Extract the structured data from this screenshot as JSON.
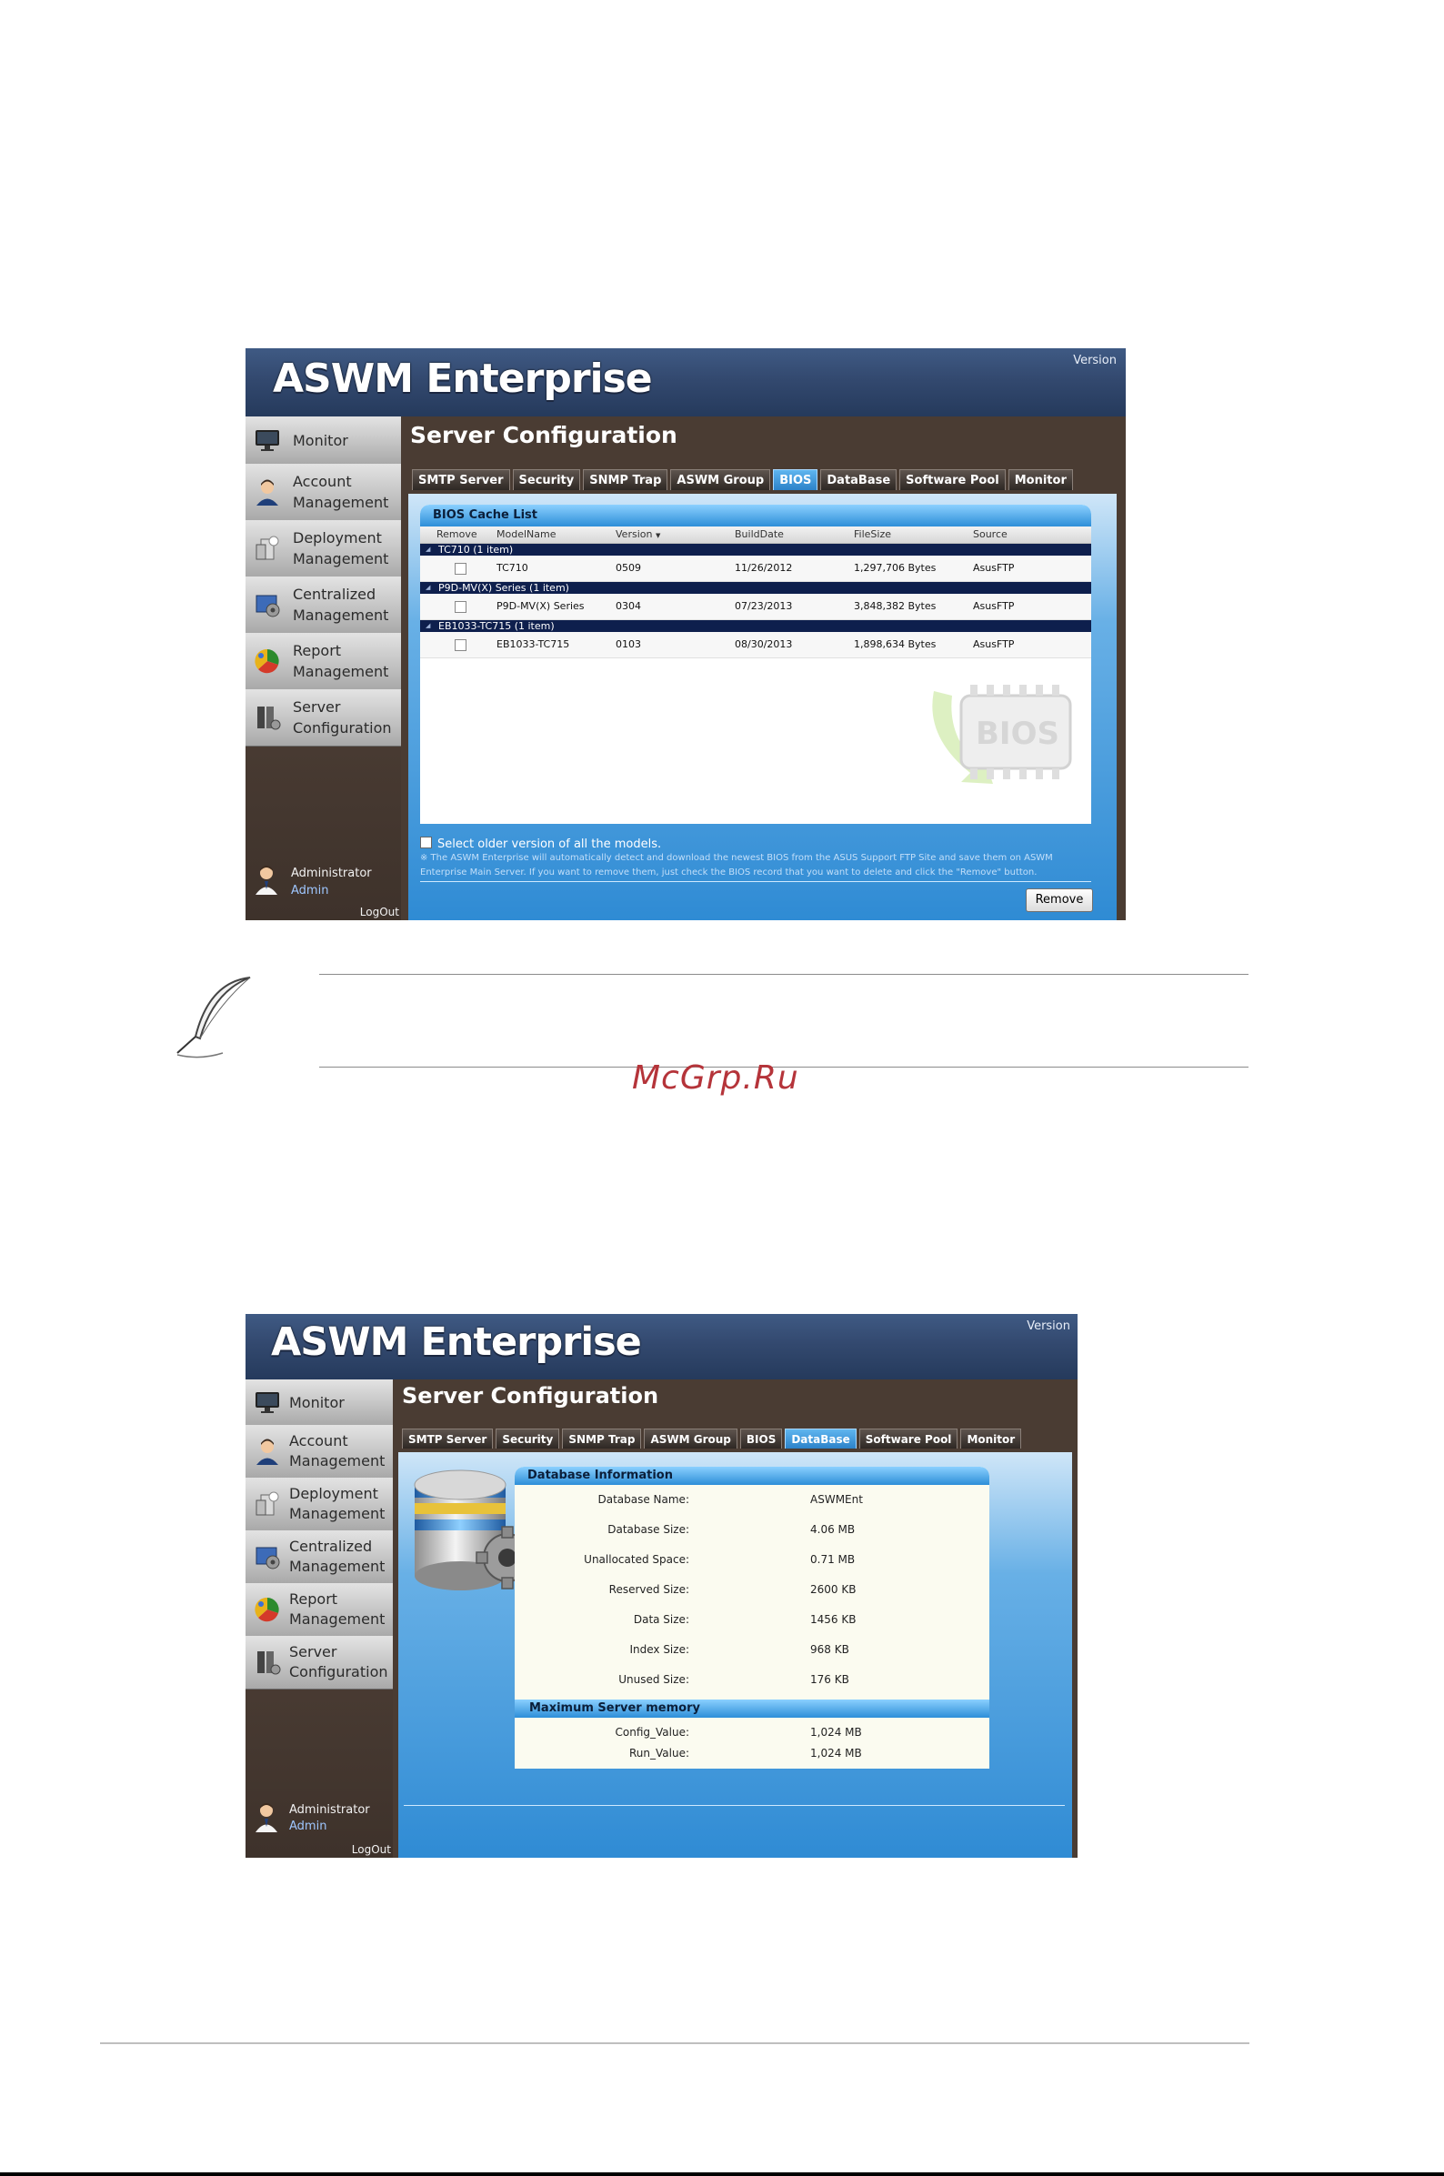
{
  "watermark": "McGrp.Ru",
  "app": {
    "brand": "ASWM Enterprise",
    "version_label": "Version",
    "page_title": "Server Configuration",
    "nav": [
      {
        "label1": "Monitor",
        "label2": "",
        "icon": "monitor-icon"
      },
      {
        "label1": "Account",
        "label2": "Management",
        "icon": "user-icon"
      },
      {
        "label1": "Deployment",
        "label2": "Management",
        "icon": "deployment-icon"
      },
      {
        "label1": "Centralized",
        "label2": "Management",
        "icon": "centralized-icon"
      },
      {
        "label1": "Report",
        "label2": "Management",
        "icon": "report-icon"
      },
      {
        "label1": "Server",
        "label2": "Configuration",
        "icon": "server-icon"
      }
    ],
    "user": {
      "role": "Administrator",
      "name": "Admin",
      "logout": "LogOut"
    },
    "tabs": [
      "SMTP Server",
      "Security",
      "SNMP Trap",
      "ASWM Group",
      "BIOS",
      "DataBase",
      "Software Pool",
      "Monitor"
    ]
  },
  "bios_screen": {
    "active_tab": "BIOS",
    "panel_title": "BIOS Cache List",
    "columns": [
      "Remove",
      "ModelName",
      "Version",
      "BuildDate",
      "FileSize",
      "Source"
    ],
    "sort_indicator": "▼",
    "groups": [
      {
        "title": "TC710 (1 item)",
        "row": {
          "model": "TC710",
          "version": "0509",
          "build_date": "11/26/2012",
          "file_size": "1,297,706 Bytes",
          "source": "AsusFTP"
        }
      },
      {
        "title": "P9D-MV(X) Series (1 item)",
        "row": {
          "model": "P9D-MV(X) Series",
          "version": "0304",
          "build_date": "07/23/2013",
          "file_size": "3,848,382 Bytes",
          "source": "AsusFTP"
        }
      },
      {
        "title": "EB1033-TC715 (1 item)",
        "row": {
          "model": "EB1033-TC715",
          "version": "0103",
          "build_date": "08/30/2013",
          "file_size": "1,898,634 Bytes",
          "source": "AsusFTP"
        }
      }
    ],
    "bios_logo_text": "BIOS",
    "older_label": "Select older version of all the models.",
    "note_line1": "※ The ASWM Enterprise will automatically detect and download the newest BIOS from the ASUS Support FTP Site and save them on ASWM",
    "note_line2": "Enterprise Main Server. If you want to remove them, just check the BIOS record that you want to delete and click the \"Remove\" button.",
    "remove_button": "Remove"
  },
  "db_screen": {
    "active_tab": "DataBase",
    "info_title": "Database Information",
    "info_rows": [
      {
        "k": "Database Name:",
        "v": "ASWMEnt"
      },
      {
        "k": "Database Size:",
        "v": "4.06 MB"
      },
      {
        "k": "Unallocated Space:",
        "v": "0.71 MB"
      },
      {
        "k": "Reserved Size:",
        "v": "2600 KB"
      },
      {
        "k": "Data Size:",
        "v": "1456 KB"
      },
      {
        "k": "Index Size:",
        "v": "968 KB"
      },
      {
        "k": "Unused Size:",
        "v": "176 KB"
      }
    ],
    "mem_title": "Maximum Server memory",
    "mem_rows": [
      {
        "k": "Config_Value:",
        "v": "1,024 MB"
      },
      {
        "k": "Run_Value:",
        "v": "1,024 MB"
      }
    ]
  }
}
